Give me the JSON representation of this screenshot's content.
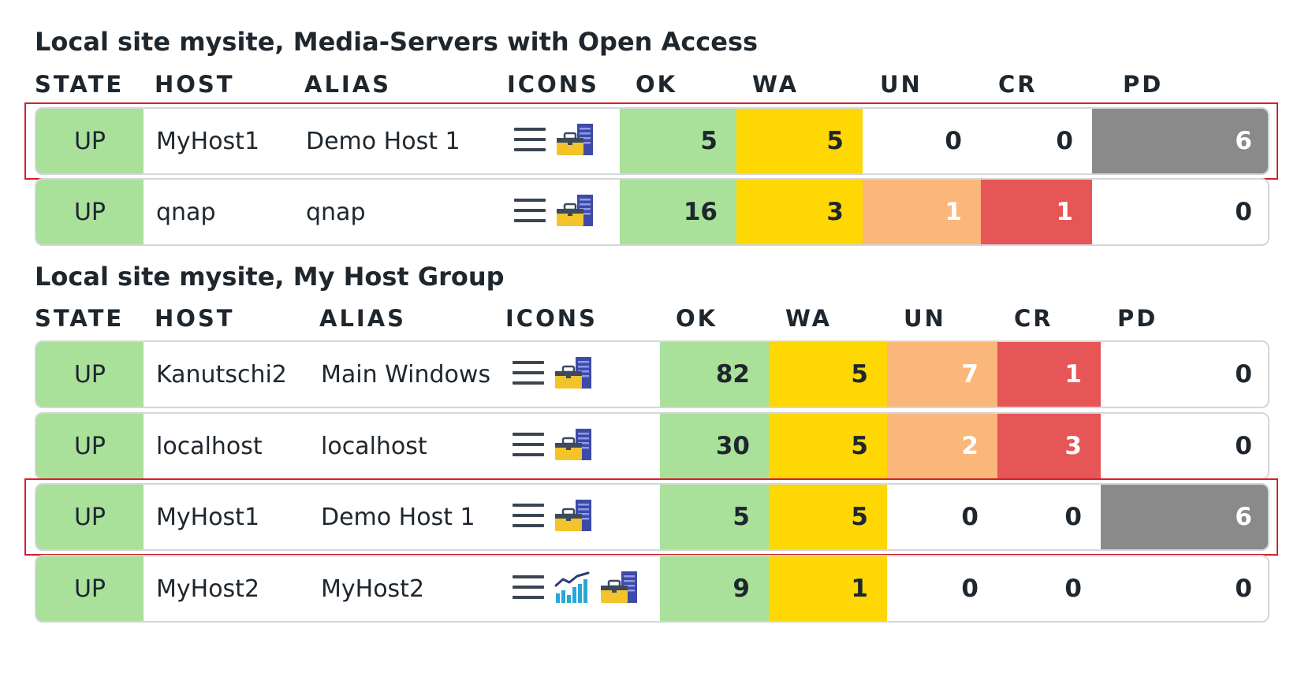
{
  "colors": {
    "up": "#a9e09a",
    "ok": "#a9e09a",
    "warn": "#ffd703",
    "unknown": "#fbb67a",
    "crit": "#e65656",
    "pending": "#8a8a8a",
    "highlight": "#d62029"
  },
  "groups": [
    {
      "title": "Local site mysite, Media-Servers with Open Access",
      "headers": [
        "STATE",
        "HOST",
        "ALIAS",
        "ICONS",
        "OK",
        "WA",
        "UN",
        "CR",
        "PD"
      ],
      "rows": [
        {
          "state": "UP",
          "host": "MyHost1",
          "alias": "Demo Host 1",
          "icons": [
            "menu-icon",
            "toolbox-server-icon"
          ],
          "ok": "5",
          "wa": "5",
          "un": "0",
          "cr": "0",
          "pd": "6",
          "highlighted": true
        },
        {
          "state": "UP",
          "host": "qnap",
          "alias": "qnap",
          "icons": [
            "menu-icon",
            "toolbox-server-icon"
          ],
          "ok": "16",
          "wa": "3",
          "un": "1",
          "cr": "1",
          "pd": "0",
          "highlighted": false
        }
      ]
    },
    {
      "title": "Local site mysite, My Host Group",
      "headers": [
        "STATE",
        "HOST",
        "ALIAS",
        "ICONS",
        "OK",
        "WA",
        "UN",
        "CR",
        "PD"
      ],
      "rows": [
        {
          "state": "UP",
          "host": "Kanutschi2",
          "alias": "Main Windows",
          "icons": [
            "menu-icon",
            "toolbox-server-icon"
          ],
          "ok": "82",
          "wa": "5",
          "un": "7",
          "cr": "1",
          "pd": "0",
          "highlighted": false
        },
        {
          "state": "UP",
          "host": "localhost",
          "alias": "localhost",
          "icons": [
            "menu-icon",
            "toolbox-server-icon"
          ],
          "ok": "30",
          "wa": "5",
          "un": "2",
          "cr": "3",
          "pd": "0",
          "highlighted": false
        },
        {
          "state": "UP",
          "host": "MyHost1",
          "alias": "Demo Host 1",
          "icons": [
            "menu-icon",
            "toolbox-server-icon"
          ],
          "ok": "5",
          "wa": "5",
          "un": "0",
          "cr": "0",
          "pd": "6",
          "highlighted": true
        },
        {
          "state": "UP",
          "host": "MyHost2",
          "alias": "MyHost2",
          "icons": [
            "menu-icon",
            "perfgraph-icon",
            "toolbox-server-icon"
          ],
          "ok": "9",
          "wa": "1",
          "un": "0",
          "cr": "0",
          "pd": "0",
          "highlighted": false
        }
      ]
    }
  ]
}
